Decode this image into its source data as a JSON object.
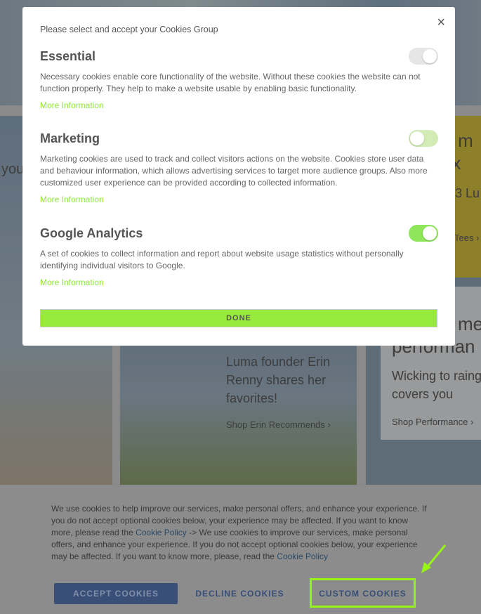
{
  "background": {
    "left_fragment": "you",
    "yellow_panel": {
      "line1": "en m",
      "line2": "mix",
      "line3": "3 Lu",
      "link": "Tees ›"
    },
    "erin_panel": {
      "text": "Luma founder Erin Renny shares her favorites!",
      "link": "Shop Erin Recommends ›"
    },
    "perf_panel": {
      "title1": "me",
      "title2": "performan",
      "text": "Wicking to raing covers you",
      "link": "Shop Performance ›"
    }
  },
  "modal": {
    "intro": "Please select and accept your Cookies Group",
    "close_icon": "×",
    "groups": [
      {
        "title": "Essential",
        "description": "Necessary cookies enable core functionality of the website. Without these cookies the website can not function properly. They help to make a website usable by enabling basic functionality.",
        "more": "More Information",
        "enabled": true,
        "disabled": true
      },
      {
        "title": "Marketing",
        "description": "Marketing cookies are used to track and collect visitors actions on the website. Cookies store user data and behaviour information, which allows advertising services to target more audience groups. Also more customized user experience can be provided according to collected information.",
        "more": "More Information",
        "enabled": false
      },
      {
        "title": "Google Analytics",
        "description": "A set of cookies to collect information and report about website usage statistics without personally identifying individual visitors to Google.",
        "more": "More Information",
        "enabled": true
      }
    ],
    "done": "DONE"
  },
  "cookie_bar": {
    "text1": "We use cookies to help improve our services, make personal offers, and enhance your experience. If you do not accept optional cookies below, your experience may be affected. If you want to know more, please read the ",
    "link1": "Cookie Policy",
    "text2": " -> We use cookies to improve our services, make personal offers, and enhance your experience. If you do not accept optional cookies below, your experience may be affected. If you want to know more, please, read the ",
    "link2": "Cookie Policy",
    "accept": "ACCEPT COOKIES",
    "decline": "DECLINE COOKIES",
    "custom": "CUSTOM COOKIES"
  },
  "colors": {
    "accent_green": "#97ea3b",
    "toggle_on": "#8ee65a",
    "toggle_off": "#d3ecb6",
    "toggle_disabled": "#e6e6e6",
    "highlight": "#97f515"
  }
}
